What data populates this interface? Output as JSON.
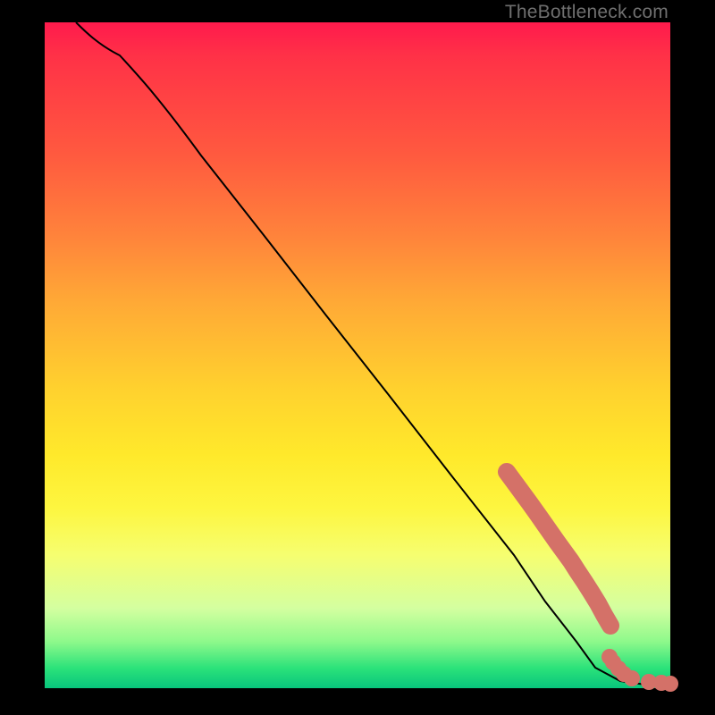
{
  "attribution": "TheBottleneck.com",
  "chart_data": {
    "type": "line",
    "title": "",
    "xlabel": "",
    "ylabel": "",
    "xlim": [
      0,
      100
    ],
    "ylim": [
      0,
      100
    ],
    "grid": false,
    "legend": false,
    "series": [
      {
        "name": "bottleneck-curve",
        "x": [
          5,
          8,
          12,
          18,
          25,
          35,
          45,
          55,
          65,
          75,
          80,
          85,
          88,
          92,
          96,
          100
        ],
        "y": [
          100,
          98,
          95,
          89,
          80,
          68,
          56,
          44,
          32,
          20,
          13,
          7,
          3,
          1,
          0.5,
          0.4
        ]
      }
    ],
    "highlight_clusters": [
      {
        "name": "upper-cluster",
        "approx_x_range": [
          75,
          84
        ],
        "approx_y_range": [
          8,
          28
        ],
        "rendered_as": "thick-stroke-along-curve"
      },
      {
        "name": "lower-tail-dots",
        "points": [
          {
            "x": 85,
            "y": 3
          },
          {
            "x": 86.5,
            "y": 2.2
          },
          {
            "x": 88,
            "y": 1.5
          },
          {
            "x": 89.5,
            "y": 1.1
          },
          {
            "x": 92,
            "y": 0.8
          },
          {
            "x": 94,
            "y": 0.6
          },
          {
            "x": 98,
            "y": 0.5
          },
          {
            "x": 100,
            "y": 0.4
          }
        ]
      }
    ],
    "background_gradient_stops": [
      {
        "pos": 0.0,
        "color": "#ff1a4d"
      },
      {
        "pos": 0.2,
        "color": "#ff5a3f"
      },
      {
        "pos": 0.42,
        "color": "#ffa936"
      },
      {
        "pos": 0.65,
        "color": "#ffe92b"
      },
      {
        "pos": 0.85,
        "color": "#d4ffa0"
      },
      {
        "pos": 1.0,
        "color": "#08c57c"
      }
    ]
  }
}
